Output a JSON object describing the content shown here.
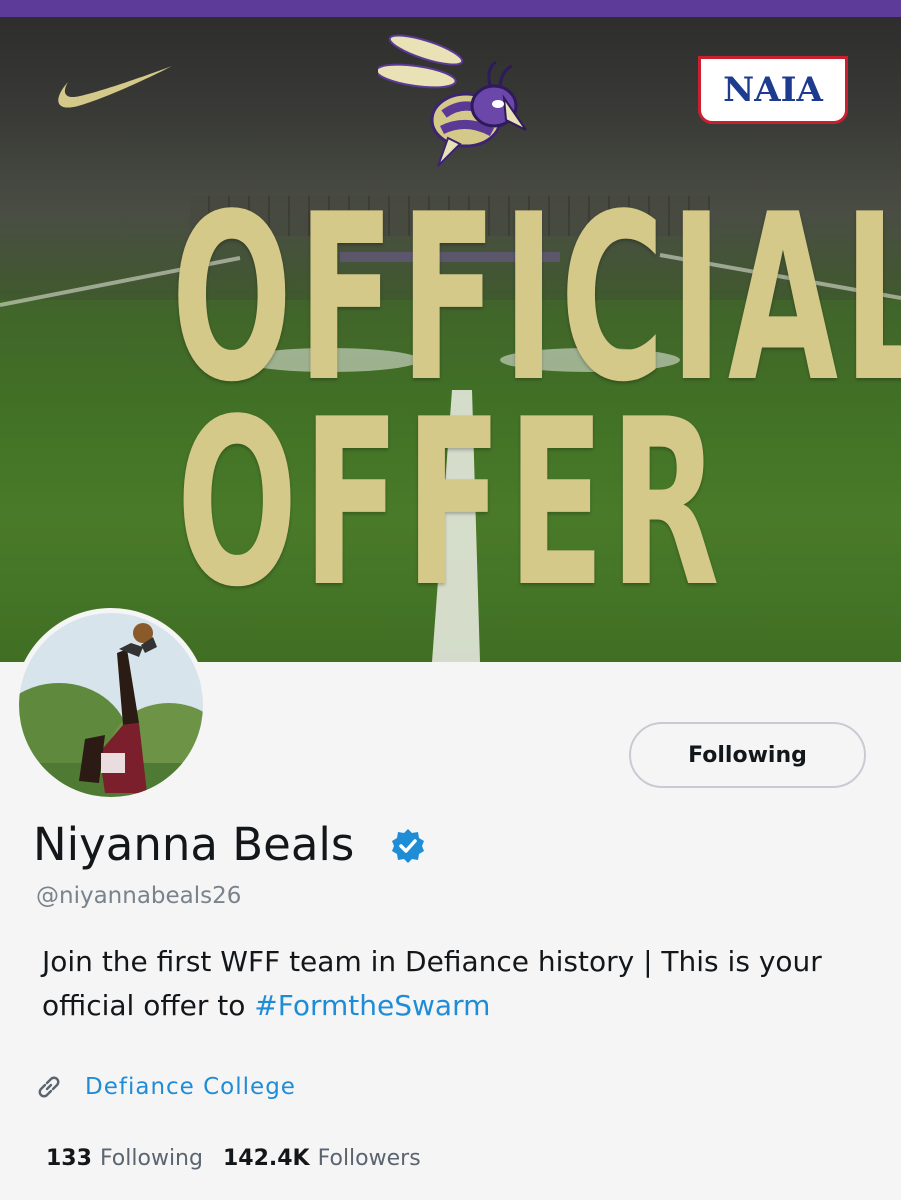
{
  "banner": {
    "headline_line1": "OFFICIAL",
    "headline_line2": "OFFER",
    "naia_logo_text": "NAIA",
    "colors": {
      "topbar": "#5c3c98",
      "gold": "#d5c98a",
      "turf": "#4c7c2a"
    },
    "icons": [
      "nike-swoosh-logo",
      "hornet-mascot-logo",
      "naia-logo"
    ]
  },
  "profile": {
    "name": "Niyanna Beals",
    "handle": "@niyannabeals26",
    "follow_button_label": "Following",
    "bio_text": "Join the first WFF team in Defiance history | This is your official offer to ",
    "bio_hashtag": "#FormtheSwarm",
    "link_text": "Defiance College",
    "stats": {
      "following_count": "133",
      "following_label": "Following",
      "followers_count": "142.4K",
      "followers_label": "Followers"
    },
    "colors": {
      "accent": "#1f8dd6",
      "text": "#14171a",
      "muted": "#7a838c"
    }
  }
}
